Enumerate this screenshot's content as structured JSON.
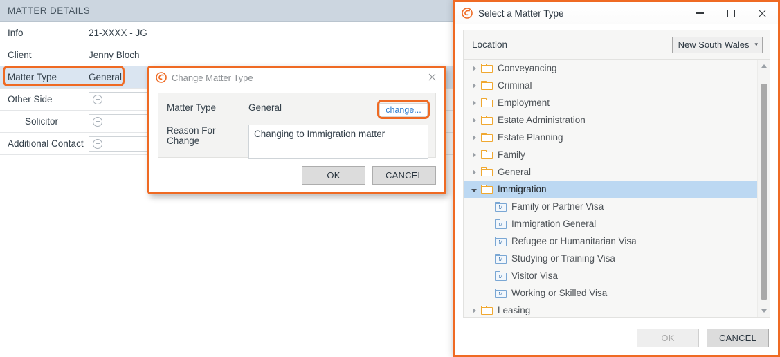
{
  "matter_details": {
    "header": "MATTER DETAILS",
    "rows": [
      {
        "label": "Info",
        "value": "21-XXXX - JG",
        "type": "text"
      },
      {
        "label": "Client",
        "value": "Jenny Bloch",
        "type": "text"
      },
      {
        "label": "Matter Type",
        "value": "General",
        "type": "text",
        "selected": true
      },
      {
        "label": "Other Side",
        "value": "",
        "type": "input",
        "icon": "plus-circle-icon"
      },
      {
        "label": "Solicitor",
        "value": "",
        "type": "input",
        "icon": "plus-circle-icon",
        "indent": true
      },
      {
        "label": "Additional Contact",
        "value": "",
        "type": "input",
        "icon": "plus-circle-icon"
      }
    ]
  },
  "change_dialog": {
    "title": "Change Matter Type",
    "logo": "smokeball-logo-icon",
    "close_icon": "close-icon",
    "matter_type_label": "Matter Type",
    "matter_type_value": "General",
    "change_link": "change...",
    "reason_label": "Reason For Change",
    "reason_value": "Changing to Immigration matter",
    "ok_label": "OK",
    "cancel_label": "CANCEL"
  },
  "select_dialog": {
    "title": "Select a Matter Type",
    "logo": "smokeball-logo-icon",
    "minimize_icon": "minimize-icon",
    "maximize_icon": "maximize-icon",
    "close_icon": "close-icon",
    "location_label": "Location",
    "location_value": "New South Wales",
    "location_chevron": "chevron-down-icon",
    "tree": [
      {
        "label": "Conveyancing",
        "level": 0,
        "icon": "folder-icon",
        "state": "collapsed",
        "selected": false
      },
      {
        "label": "Criminal",
        "level": 0,
        "icon": "folder-icon",
        "state": "collapsed",
        "selected": false
      },
      {
        "label": "Employment",
        "level": 0,
        "icon": "folder-icon",
        "state": "collapsed",
        "selected": false
      },
      {
        "label": "Estate Administration",
        "level": 0,
        "icon": "folder-icon",
        "state": "collapsed",
        "selected": false
      },
      {
        "label": "Estate Planning",
        "level": 0,
        "icon": "folder-icon",
        "state": "collapsed",
        "selected": false
      },
      {
        "label": "Family",
        "level": 0,
        "icon": "folder-icon",
        "state": "collapsed",
        "selected": false
      },
      {
        "label": "General",
        "level": 0,
        "icon": "folder-icon",
        "state": "collapsed",
        "selected": false
      },
      {
        "label": "Immigration",
        "level": 0,
        "icon": "folder-icon",
        "state": "expanded",
        "selected": true
      },
      {
        "label": "Family or Partner Visa",
        "level": 1,
        "icon": "matter-type-icon",
        "state": "leaf",
        "selected": false
      },
      {
        "label": "Immigration General",
        "level": 1,
        "icon": "matter-type-icon",
        "state": "leaf",
        "selected": false
      },
      {
        "label": "Refugee or Humanitarian Visa",
        "level": 1,
        "icon": "matter-type-icon",
        "state": "leaf",
        "selected": false
      },
      {
        "label": "Studying or Training Visa",
        "level": 1,
        "icon": "matter-type-icon",
        "state": "leaf",
        "selected": false
      },
      {
        "label": "Visitor Visa",
        "level": 1,
        "icon": "matter-type-icon",
        "state": "leaf",
        "selected": false
      },
      {
        "label": "Working or Skilled Visa",
        "level": 1,
        "icon": "matter-type-icon",
        "state": "leaf",
        "selected": false
      },
      {
        "label": "Leasing",
        "level": 0,
        "icon": "folder-icon",
        "state": "collapsed",
        "selected": false
      }
    ],
    "ok_label": "OK",
    "cancel_label": "CANCEL",
    "ok_disabled": true
  },
  "colors": {
    "accent_orange": "#ef6a23",
    "folder_orange": "#f0a830",
    "selection_blue": "#bcd8f2",
    "row_selection_blue": "#dae5f1",
    "header_blue_gray": "#ccd6e0",
    "link_blue": "#2f7fd0"
  }
}
